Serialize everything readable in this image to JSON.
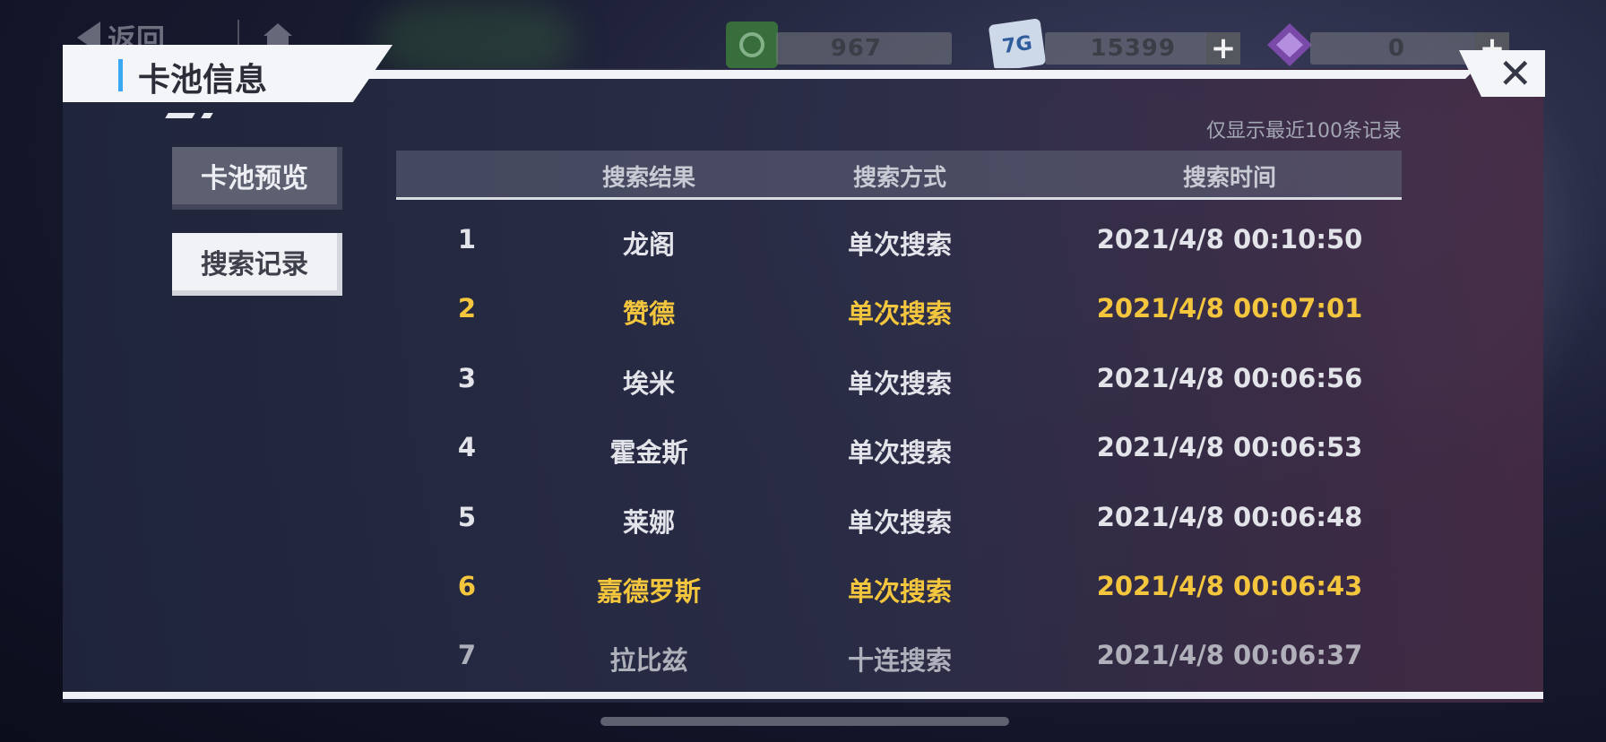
{
  "topbar": {
    "back_label": "返回",
    "resources": [
      {
        "name": "green-ticket",
        "value": "967",
        "icon": "ticket-icon",
        "color": "#3d7f3b"
      },
      {
        "name": "card-7g",
        "value": "15399",
        "icon": "card-7g-icon",
        "icon_text": "7G",
        "color": "#cdd8e8"
      },
      {
        "name": "purple-crystal",
        "value": "0",
        "icon": "crystal-icon",
        "color": "#7a4aa8"
      }
    ]
  },
  "panel": {
    "title": "卡池信息",
    "close_label": "✕",
    "tabs": [
      {
        "label": "卡池预览",
        "active": false
      },
      {
        "label": "搜索记录",
        "active": true
      }
    ],
    "note": "仅显示最近100条记录"
  },
  "table": {
    "headers": [
      "搜索结果",
      "搜索方式",
      "搜索时间"
    ],
    "rows": [
      {
        "index": "1",
        "result": "龙阁",
        "method": "单次搜索",
        "time": "2021/4/8  00:10:50",
        "highlight": false
      },
      {
        "index": "2",
        "result": "赞德",
        "method": "单次搜索",
        "time": "2021/4/8  00:07:01",
        "highlight": true
      },
      {
        "index": "3",
        "result": "埃米",
        "method": "单次搜索",
        "time": "2021/4/8  00:06:56",
        "highlight": false
      },
      {
        "index": "4",
        "result": "霍金斯",
        "method": "单次搜索",
        "time": "2021/4/8  00:06:53",
        "highlight": false
      },
      {
        "index": "5",
        "result": "莱娜",
        "method": "单次搜索",
        "time": "2021/4/8  00:06:48",
        "highlight": false
      },
      {
        "index": "6",
        "result": "嘉德罗斯",
        "method": "单次搜索",
        "time": "2021/4/8  00:06:43",
        "highlight": true
      },
      {
        "index": "7",
        "result": "拉比兹",
        "method": "十连搜索",
        "time": "2021/4/8  00:06:37",
        "highlight": false
      }
    ]
  },
  "colors": {
    "highlight": "#f4c63d",
    "accent": "#3ba9f2"
  }
}
